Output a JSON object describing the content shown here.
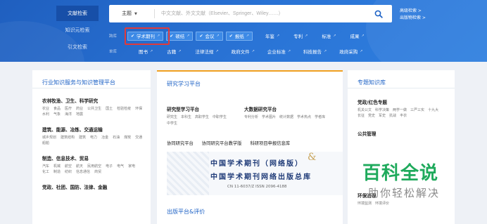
{
  "side_tabs": [
    {
      "label": "文献检索",
      "active": true
    },
    {
      "label": "知识元检索",
      "active": false
    },
    {
      "label": "引文检索",
      "active": false
    }
  ],
  "search": {
    "scope": "主题",
    "placeholder": "中文文献、外文文献（Elsevier、Springer、Wiley……）"
  },
  "advanced_links": [
    "高级检索 >",
    "出版物检索 >"
  ],
  "filters": {
    "row1_label": "跨库",
    "row1_checked": [
      "学术期刊",
      "硕结",
      "会议",
      "报纸"
    ],
    "row1_unchecked": [
      "年鉴",
      "专利",
      "标准",
      "成果"
    ],
    "row2_label": "单库",
    "row2_items": [
      "图书",
      "古籍",
      "法律法规",
      "政府文件",
      "企业标准",
      "科技报告",
      "政府采购"
    ]
  },
  "panel_left": {
    "title": "行业知识服务与知识管理平台",
    "categories": [
      {
        "title": "农林牧渔、卫生、科学研究",
        "items": [
          "农业",
          "食品",
          "医疗",
          "药业",
          "公共卫生",
          "国土",
          "检验检疫",
          "环保",
          "水利",
          "气象",
          "海洋",
          "地震"
        ]
      },
      {
        "title": "建筑、能源、冶炼、交通运输",
        "items": [
          "城乡规划",
          "建筑结构",
          "建筑",
          "电力",
          "冶金",
          "石油",
          "煤炭",
          "交通",
          "船舶"
        ]
      },
      {
        "title": "制造、信息技术、贸易",
        "items": [
          "汽车",
          "机械",
          "航空",
          "航天",
          "民用航空",
          "电子",
          "电气",
          "家电",
          "化工",
          "制造",
          "纺织",
          "信息通信",
          "商贸"
        ]
      },
      {
        "title": "党政、社团、国防、法律、金融",
        "items": []
      }
    ]
  },
  "panel_middle": {
    "title": "研究学习平台",
    "study_title": "研究型学习平台",
    "study_items": [
      "研究生",
      "本科生",
      "高职学生",
      "中职学生",
      "中学生"
    ],
    "bigdata_title": "大数据研究平台",
    "bigdata_items": [
      "专利分析",
      "学术图片",
      "统计数据",
      "学术热点",
      "学者库"
    ],
    "links": [
      "协同研究平台",
      "协同研究平台教学版",
      "科研项目申报信息库"
    ],
    "banner": {
      "line1": "中国学术期刊（网络版）",
      "amp": "&",
      "line2": "中国学术期刊网络出版总库",
      "issn": "CN 11-6037/Z    ISSN 2096-4188"
    },
    "publish_title": "出版平台&评价"
  },
  "panel_right": {
    "title": "专题知识库",
    "topics": [
      {
        "title": "党政/红色专题",
        "items": [
          "机关公文",
          "科学决策",
          "两学一做",
          "三严三实",
          "十九大",
          "长征",
          "党史",
          "军史",
          "抗战",
          "丰衣"
        ]
      },
      {
        "title": "公共管理",
        "items": []
      },
      {
        "title": "环保治理",
        "items": [
          "环境监测",
          "环境评价"
        ]
      }
    ]
  },
  "watermark": {
    "main": "百科全说",
    "sub": "助你轻松解决"
  },
  "colors": {
    "hero": "#2a74d6",
    "accent": "#1f63c6",
    "highlight": "#e23a3a",
    "watermark": "#1faa5c"
  }
}
